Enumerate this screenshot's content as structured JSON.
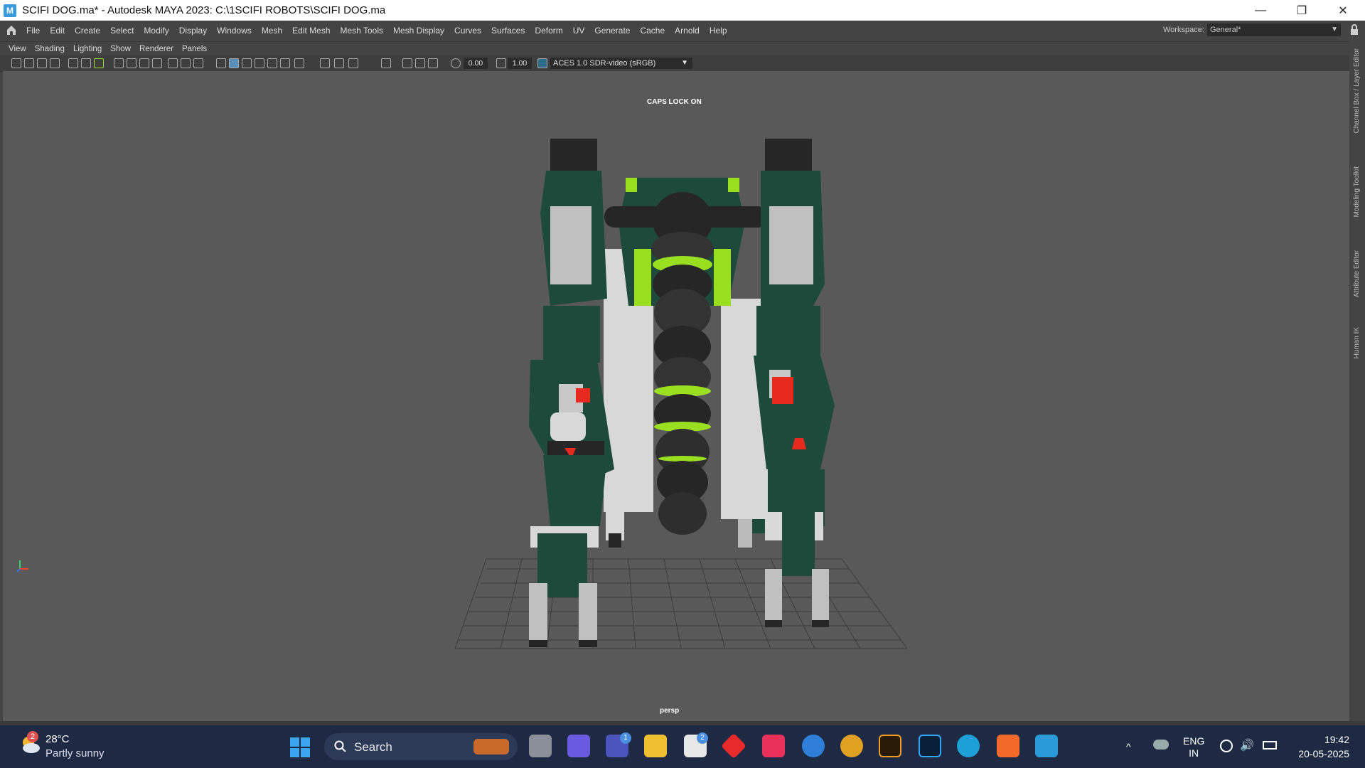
{
  "window": {
    "title": "SCIFI DOG.ma* - Autodesk MAYA 2023: C:\\1SCIFI ROBOTS\\SCIFI DOG.ma",
    "app_icon_letter": "M",
    "controls": {
      "minimize": "—",
      "restore": "❐",
      "close": "✕"
    }
  },
  "menubar": {
    "items": [
      "File",
      "Edit",
      "Create",
      "Select",
      "Modify",
      "Display",
      "Windows",
      "Mesh",
      "Edit Mesh",
      "Mesh Tools",
      "Mesh Display",
      "Curves",
      "Surfaces",
      "Deform",
      "UV",
      "Generate",
      "Cache",
      "Arnold",
      "Help"
    ],
    "workspace_label": "Workspace:",
    "workspace_value": "General*"
  },
  "panel": {
    "menu": [
      "View",
      "Shading",
      "Lighting",
      "Show",
      "Renderer",
      "Panels"
    ],
    "toolbar": {
      "value_a": "0.00",
      "value_b": "1.00",
      "color_management": "ACES 1.0 SDR-video (sRGB)"
    }
  },
  "viewport": {
    "caps_lock": "CAPS LOCK ON",
    "camera": "persp",
    "colors": {
      "body": "#1e4a3c",
      "accent": "#9adf1f",
      "light": "#d8d8d8",
      "dark": "#262626",
      "warning": "#e82a1e"
    }
  },
  "sidebar": {
    "tabs": [
      "Channel Box / Layer Editor",
      "Modeling Toolkit",
      "Attribute Editor",
      "Human IK"
    ]
  },
  "taskbar": {
    "weather": {
      "temp": "28°C",
      "condition": "Partly sunny",
      "badge": "2"
    },
    "search": "Search",
    "badges": {
      "teams": "1",
      "store": "2"
    },
    "lang_1": "ENG",
    "lang_2": "IN",
    "time": "19:42",
    "date": "20-05-2025"
  }
}
